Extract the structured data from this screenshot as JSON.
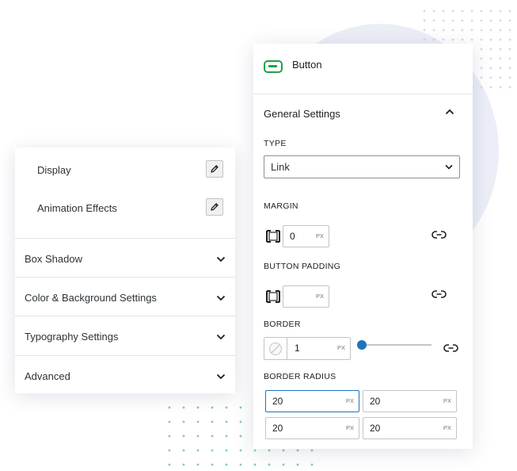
{
  "left_panel": {
    "rows": [
      {
        "label": "Display",
        "icon": "pencil-icon"
      },
      {
        "label": "Animation Effects",
        "icon": "pencil-icon"
      }
    ],
    "sections": [
      {
        "label": "Box Shadow"
      },
      {
        "label": "Color & Background Settings"
      },
      {
        "label": "Typography Settings"
      },
      {
        "label": "Advanced"
      }
    ]
  },
  "right_panel": {
    "block_title": "Button",
    "block_icon": "button-block-icon",
    "accent_color": "#1ba34b",
    "general_settings_label": "General Settings",
    "type_label": "TYPE",
    "type_value": "Link",
    "margin_label": "MARGIN",
    "margin_value": "0",
    "margin_unit": "PX",
    "padding_label": "BUTTON PADDING",
    "padding_value": "",
    "padding_unit": "PX",
    "border_label": "BORDER",
    "border_value": "1",
    "border_unit": "PX",
    "border_slider_color": "#1e73be",
    "border_radius_label": "BORDER RADIUS",
    "border_radius": [
      {
        "value": "20",
        "unit": "PX"
      },
      {
        "value": "20",
        "unit": "PX"
      },
      {
        "value": "20",
        "unit": "PX"
      },
      {
        "value": "20",
        "unit": "PX"
      }
    ]
  }
}
